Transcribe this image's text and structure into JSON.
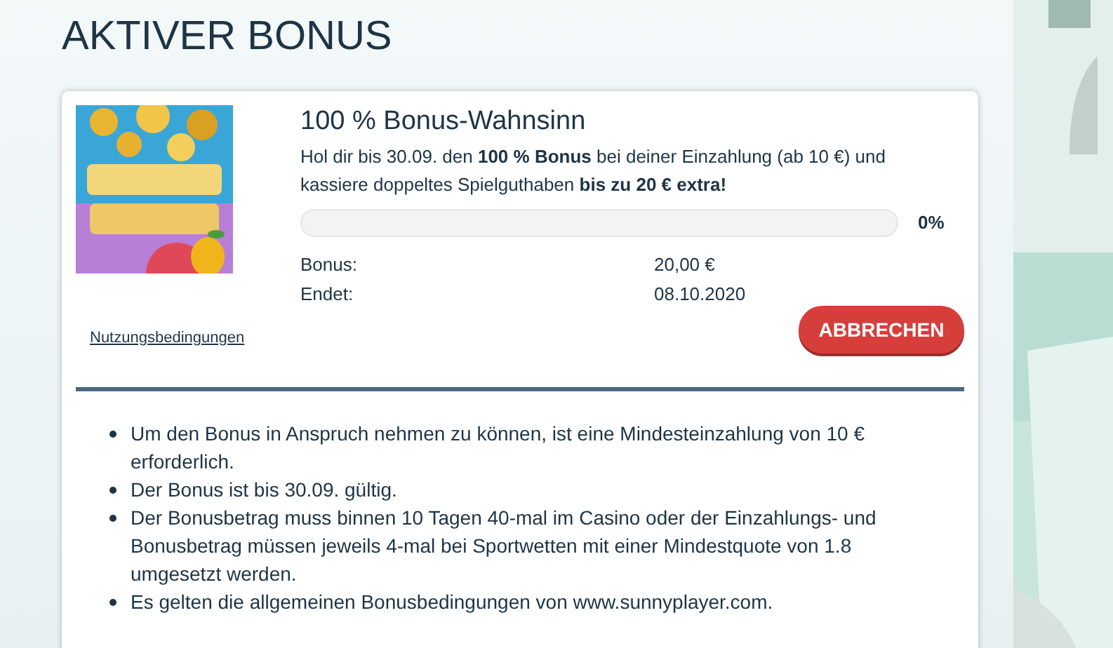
{
  "page_title": "AKTIVER BONUS",
  "bonus": {
    "title": "100 % Bonus-Wahnsinn",
    "description": "Hol dir bis 30.09. den **100 % Bonus** bei deiner Einzahlung (ab 10 €) und kassiere doppeltes Spielguthaben **bis zu 20 € extra!**",
    "progress": {
      "level": 0,
      "reading": "0%"
    },
    "details": [
      {
        "label": "Bonus:",
        "value": "20,00 €"
      },
      {
        "label": "Endet:",
        "value": "08.10.2020"
      }
    ],
    "terms_link": "Nutzungsbedingungen",
    "cancel_button": "ABBRECHEN"
  },
  "conditions": [
    "Um den Bonus in Anspruch nehmen zu können, ist eine Mindesteinzahlung von 10 € erforderlich.",
    "Der Bonus ist bis 30.09. gültig.",
    "Der Bonusbetrag muss binnen 10 Tagen 40-mal im Casino oder der Einzahlungs- und Bonusbetrag müssen jeweils 4-mal bei Sportwetten mit einer Mindestquote von 1.8 umgesetzt werden.",
    "Es gelten die allgemeinen Bonusbedingungen von www.sunnyplayer.com."
  ]
}
